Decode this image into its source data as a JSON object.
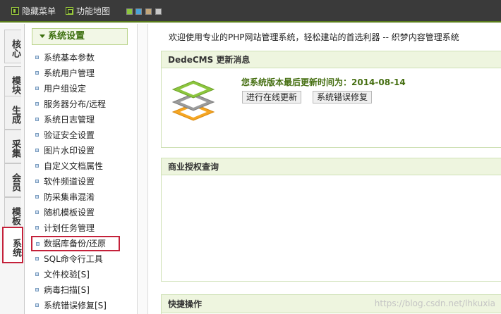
{
  "topbar": {
    "hide_menu_label": "隐藏菜单",
    "hide_menu_icon": "panel-toggle-icon",
    "site_map_label": "功能地图",
    "site_map_icon": "map-icon",
    "theme_swatches": [
      {
        "name": "green",
        "color": "#8cc63e"
      },
      {
        "name": "blue",
        "color": "#4aa3d8"
      },
      {
        "name": "brown",
        "color": "#c4a77b"
      },
      {
        "name": "gray",
        "color": "#c8c8c8"
      }
    ]
  },
  "vtabs": [
    {
      "label": "核心",
      "active": false
    },
    {
      "label": "模块",
      "active": false
    },
    {
      "label": "生成",
      "active": false
    },
    {
      "label": "采集",
      "active": false
    },
    {
      "label": "会员",
      "active": false
    },
    {
      "label": "模板",
      "active": false
    },
    {
      "label": "系统",
      "active": true
    }
  ],
  "menu": {
    "title": "系统设置",
    "items": [
      "系统基本参数",
      "系统用户管理",
      "用户组设定",
      "服务器分布/远程",
      "系统日志管理",
      "验证安全设置",
      "图片水印设置",
      "自定义文档属性",
      "软件频道设置",
      "防采集串混淆",
      "随机模板设置",
      "计划任务管理",
      "数据库备份/还原",
      "SQL命令行工具",
      "文件校验[S]",
      "病毒扫描[S]",
      "系统错误修复[S]"
    ],
    "selected_index": 12
  },
  "main": {
    "welcome": "欢迎使用专业的PHP网站管理系统，轻松建站的首选利器 -- 织梦内容管理系统",
    "update_panel": {
      "title": "DedeCMS 更新消息",
      "version_text": "您系统版本最后更新时间为：2014-08-14",
      "online_update_button": "进行在线更新",
      "fix_button": "系统错误修复"
    },
    "license_panel": {
      "title": "商业授权查询"
    },
    "quick_panel": {
      "title": "快捷操作"
    }
  },
  "watermark": "https://blog.csdn.net/lhkuxia",
  "colors": {
    "accent_green": "#5a7d1a",
    "selection_red": "#c4213a",
    "panel_border": "#cfe1b6"
  }
}
